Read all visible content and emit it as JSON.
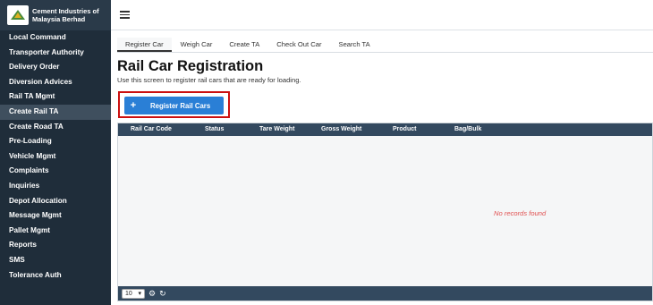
{
  "brand": {
    "line1": "Cement Industries of",
    "line2": "Malaysia Berhad"
  },
  "sidebar": {
    "items": [
      {
        "label": "Local Command"
      },
      {
        "label": "Transporter Authority"
      },
      {
        "label": "Delivery Order"
      },
      {
        "label": "Diversion Advices"
      },
      {
        "label": "Rail TA Mgmt"
      },
      {
        "label": "Create Rail TA"
      },
      {
        "label": "Create Road TA"
      },
      {
        "label": "Pre-Loading"
      },
      {
        "label": "Vehicle Mgmt"
      },
      {
        "label": "Complaints"
      },
      {
        "label": "Inquiries"
      },
      {
        "label": "Depot Allocation"
      },
      {
        "label": "Message Mgmt"
      },
      {
        "label": "Pallet Mgmt"
      },
      {
        "label": "Reports"
      },
      {
        "label": "SMS"
      },
      {
        "label": "Tolerance Auth"
      }
    ],
    "active_index": 5
  },
  "tabs": [
    {
      "label": "Register Car"
    },
    {
      "label": "Weigh Car"
    },
    {
      "label": "Create TA"
    },
    {
      "label": "Check Out Car"
    },
    {
      "label": "Search TA"
    }
  ],
  "page": {
    "title": "Rail Car Registration",
    "subtitle": "Use this screen to register rail cars that are ready for loading."
  },
  "register_button": {
    "label": "Register Rail Cars",
    "icon": "plus-icon"
  },
  "table": {
    "columns": [
      "Rail Car Code",
      "Status",
      "Tare Weight",
      "Gross Weight",
      "Product",
      "Bag/Bulk"
    ],
    "empty_message": "No records found",
    "page_size": "10"
  },
  "colors": {
    "sidebar_bg": "#1f2d3a",
    "accent": "#2a7fd6",
    "table_header": "#33495f",
    "highlight_border": "#cc1010",
    "empty_text": "#e05050"
  }
}
